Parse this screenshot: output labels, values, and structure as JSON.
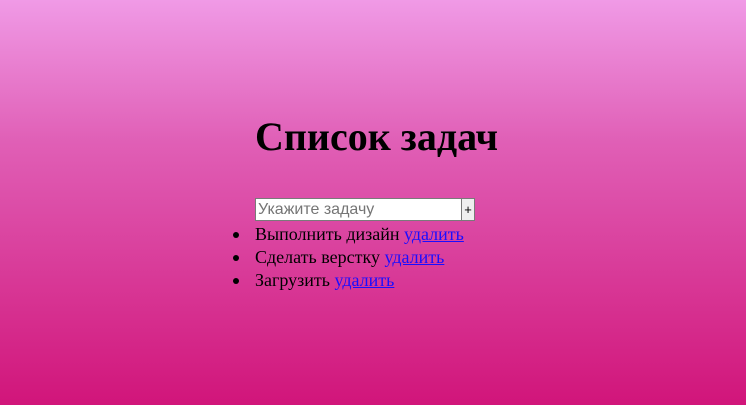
{
  "header": {
    "title": "Список задач"
  },
  "form": {
    "input_placeholder": "Укажите задачу",
    "input_value": "",
    "add_label": "+"
  },
  "tasks": [
    {
      "text": "Выполнить дизайн",
      "delete_label": "удалить"
    },
    {
      "text": "Сделать верстку",
      "delete_label": "удалить"
    },
    {
      "text": "Загрузить",
      "delete_label": "удалить"
    }
  ],
  "colors": {
    "background_top": "#f09ae6",
    "background_bottom": "#d1157a",
    "link": "#1a0dff"
  }
}
